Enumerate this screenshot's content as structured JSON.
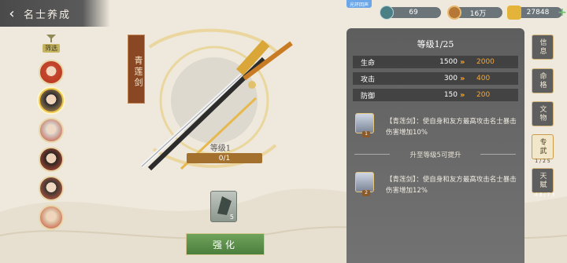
{
  "header": {
    "title": "名士养成",
    "back_icon": "back-arrow-icon"
  },
  "top_tag": "光环回声",
  "resources": [
    {
      "name": "gem",
      "value": "69"
    },
    {
      "name": "copper-coin",
      "value": "16万"
    },
    {
      "name": "gold-ingot",
      "value": "27848"
    }
  ],
  "filter": {
    "label": "筛选"
  },
  "characters": [
    {
      "name": "char-1",
      "selected": false
    },
    {
      "name": "char-2",
      "selected": true
    },
    {
      "name": "char-3",
      "selected": false
    },
    {
      "name": "char-4",
      "selected": false
    },
    {
      "name": "char-5",
      "selected": false
    },
    {
      "name": "char-6",
      "selected": false
    }
  ],
  "weapon": {
    "name": "青莲剑",
    "level_label": "等级1",
    "progress_text": "0/1",
    "progress_fraction": 0.0,
    "item_count": "5",
    "enhance_label": "强化"
  },
  "panel": {
    "title": "等级1/25",
    "stats": [
      {
        "name": "生命",
        "current": "1500",
        "next": "2000"
      },
      {
        "name": "攻击",
        "current": "300",
        "next": "400"
      },
      {
        "name": "防御",
        "current": "150",
        "next": "200"
      }
    ],
    "skill1": {
      "level": "1",
      "text": "【青莲剑】：使自身和友方最高攻击名士暴击伤害增加10%"
    },
    "divider": "升至等级5可提升",
    "skill2": {
      "level": "2",
      "text": "【青莲剑】：使自身和友方最高攻击名士暴击伤害增加12%"
    }
  },
  "side_tabs": [
    {
      "label": "信息",
      "sub": ""
    },
    {
      "label": "命格",
      "sub": ""
    },
    {
      "label": "文物",
      "sub": ""
    },
    {
      "label": "专武",
      "sub": "1/25"
    },
    {
      "label": "天赋",
      "sub": "48/73"
    }
  ],
  "colors": {
    "accent": "#f5a838",
    "enhance": "#5b8f48",
    "panel": "#626262"
  }
}
